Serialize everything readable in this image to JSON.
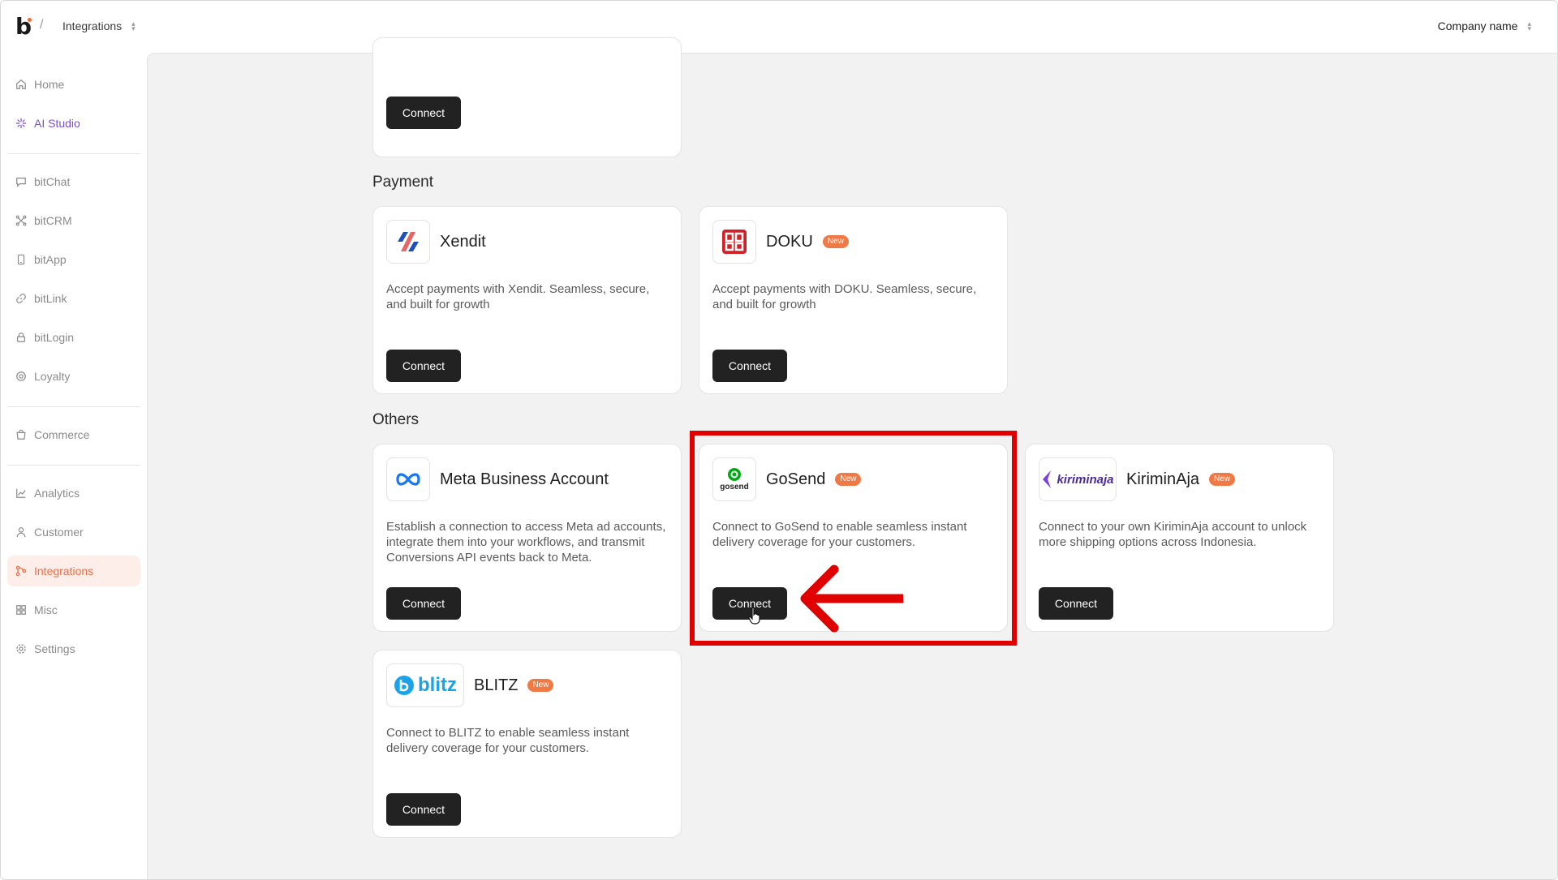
{
  "topbar": {
    "logo": "b",
    "separator": "/",
    "breadcrumb": "Integrations",
    "company": "Company name",
    "updown": "⌃⌄"
  },
  "sidebar": {
    "items": [
      {
        "label": "Home",
        "icon": "home-icon"
      },
      {
        "label": "AI Studio",
        "icon": "sparkle-icon"
      },
      {
        "label": "bitChat",
        "icon": "chat-icon"
      },
      {
        "label": "bitCRM",
        "icon": "crm-icon"
      },
      {
        "label": "bitApp",
        "icon": "phone-icon"
      },
      {
        "label": "bitLink",
        "icon": "link-icon"
      },
      {
        "label": "bitLogin",
        "icon": "lock-icon"
      },
      {
        "label": "Loyalty",
        "icon": "loyalty-icon"
      },
      {
        "label": "Commerce",
        "icon": "bag-icon"
      },
      {
        "label": "Analytics",
        "icon": "chart-icon"
      },
      {
        "label": "Customer",
        "icon": "user-icon"
      },
      {
        "label": "Integrations",
        "icon": "integrations-icon"
      },
      {
        "label": "Misc",
        "icon": "grid-icon"
      },
      {
        "label": "Settings",
        "icon": "settings-icon"
      }
    ],
    "active": "Integrations"
  },
  "sections": {
    "payment": "Payment",
    "others": "Others"
  },
  "cards": {
    "top": {
      "button": "Connect"
    },
    "xendit": {
      "title": "Xendit",
      "desc": "Accept payments with Xendit. Seamless, secure, and built for growth",
      "button": "Connect"
    },
    "doku": {
      "title": "DOKU",
      "badge": "New",
      "desc": "Accept payments with DOKU. Seamless, secure, and built for growth",
      "button": "Connect"
    },
    "meta": {
      "title": "Meta Business Account",
      "desc": "Establish a connection to access Meta ad accounts, integrate them into your workflows, and transmit Conversions API events back to Meta.",
      "button": "Connect"
    },
    "gosend": {
      "title": "GoSend",
      "badge": "New",
      "logo_text": "gosend",
      "desc": "Connect to GoSend to enable seamless instant delivery coverage for your customers.",
      "button": "Connect"
    },
    "kiriminaja": {
      "title": "KiriminAja",
      "badge": "New",
      "logo_text": "kiriminaja",
      "desc": "Connect to your own KiriminAja account to unlock more shipping options across Indonesia.",
      "button": "Connect"
    },
    "blitz": {
      "title": "BLITZ",
      "badge": "New",
      "logo_text": "blitz",
      "desc": "Connect to BLITZ to enable seamless instant delivery coverage for your customers.",
      "button": "Connect"
    }
  },
  "annotation": {
    "color": "#e00000",
    "target": "gosend-card"
  },
  "colors": {
    "accent": "#ee6c43",
    "ai_studio": "#7b4fd1",
    "button": "#222222",
    "badge": "#f07a45"
  }
}
